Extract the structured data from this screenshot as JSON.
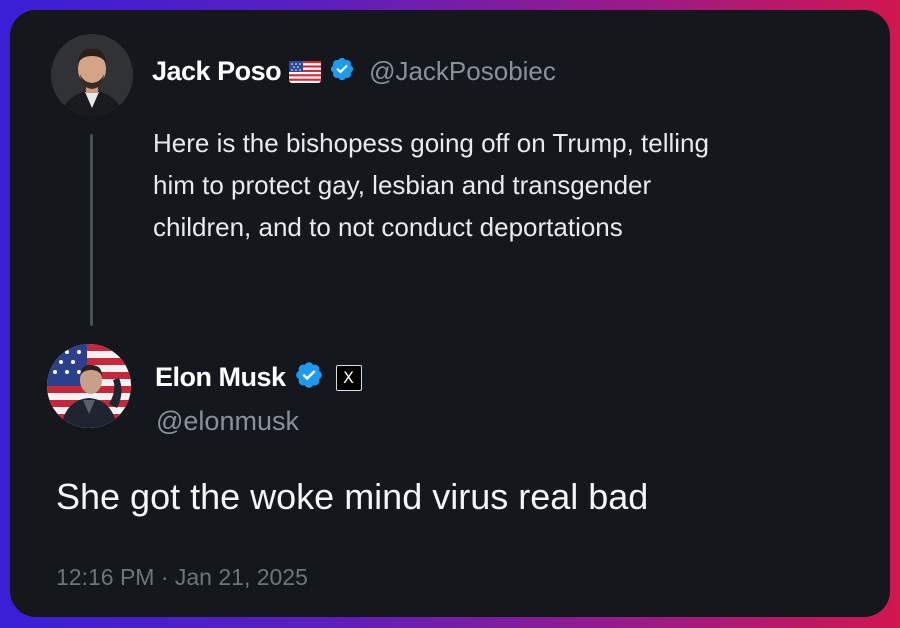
{
  "quoted_tweet": {
    "author_name": "Jack Poso",
    "author_handle": "@JackPosobiec",
    "author_flag": "us-flag-icon",
    "verified": true,
    "text": "Here is the bishopess going off on Trump, telling him to protect gay, lesbian and transgender children, and to not conduct deportations"
  },
  "reply_tweet": {
    "author_name": "Elon Musk",
    "author_handle": "@elonmusk",
    "verified": true,
    "affiliate_badge": "X",
    "text": "She got the woke mind virus real bad",
    "timestamp": "12:16 PM · Jan 21, 2025"
  },
  "colors": {
    "card_background": "#14171c",
    "verified_blue": "#1d9bf0",
    "handle_gray": "#8b9199",
    "text_white": "#e9eaec",
    "thread_line": "#4a4e55"
  }
}
